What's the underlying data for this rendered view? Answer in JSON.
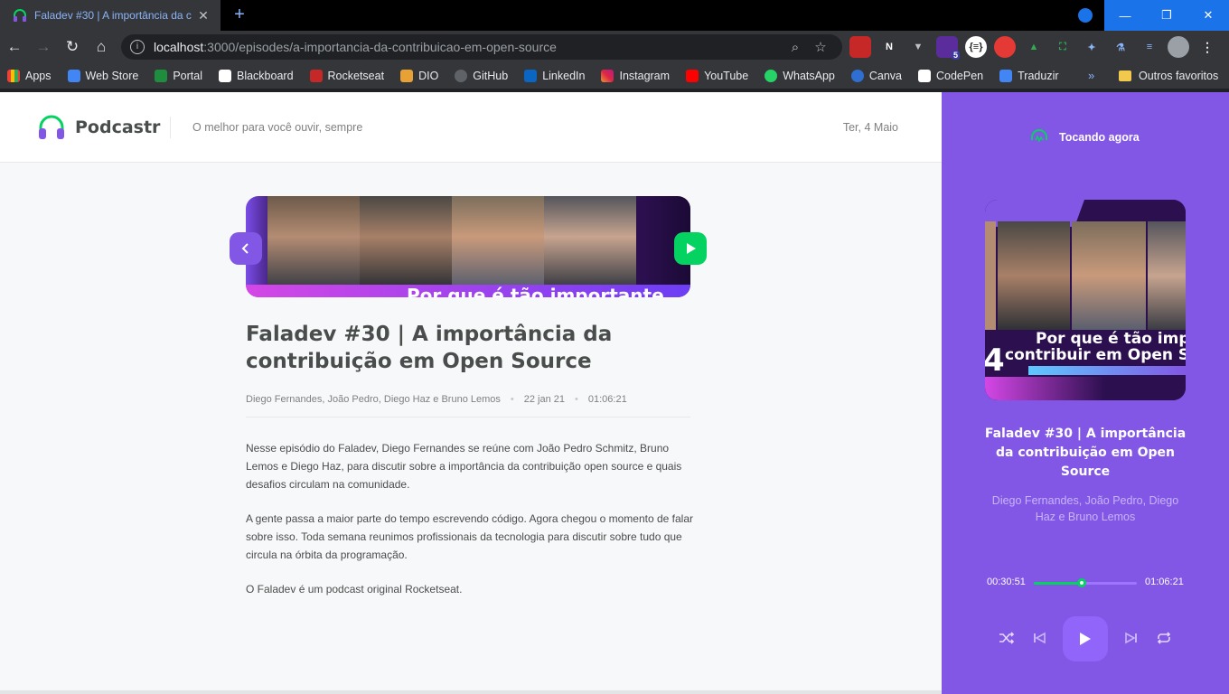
{
  "browser": {
    "tab_title": "Faladev #30 | A importância da c",
    "url_host": "localhost",
    "url_rest": ":3000/episodes/a-importancia-da-contribuicao-em-open-source",
    "bookmarks": [
      "Apps",
      "Web Store",
      "Portal",
      "Blackboard",
      "Rocketseat",
      "DIO",
      "GitHub",
      "LinkedIn",
      "Instagram",
      "YouTube",
      "WhatsApp",
      "Canva",
      "CodePen",
      "Traduzir"
    ],
    "bookmarks_more": "»",
    "other_bookmarks": "Outros favoritos",
    "ext_badge": "5"
  },
  "header": {
    "logo": "Podcastr",
    "tagline": "O melhor para você ouvir, sempre",
    "date": "Ter, 4 Maio"
  },
  "episode": {
    "thumbnail_caption": "Por que é tão importante",
    "title": "Faladev #30 | A importância da contribuição em Open Source",
    "members": "Diego Fernandes, João Pedro, Diego Haz e Bruno Lemos",
    "published_at": "22 jan 21",
    "duration": "01:06:21",
    "description": [
      "Nesse episódio do Faladev, Diego Fernandes se reúne com João Pedro Schmitz, Bruno Lemos e Diego Haz, para discutir sobre a importância da contribuição open source e quais desafios circulam na comunidade.",
      "A gente passa a maior parte do tempo escrevendo código. Agora chegou o momento de falar sobre isso. Toda semana reunimos profissionais da tecnologia para discutir sobre tudo que circula na órbita da programação.",
      "O Faladev é um podcast original Rocketseat."
    ]
  },
  "player": {
    "now_playing": "Tocando agora",
    "cover_caption_line1": "Por que é tão imp",
    "cover_caption_line2": "contribuir em Open S",
    "cover_number": "4",
    "title": "Faladev #30 | A importância da contribuição em Open Source",
    "members": "Diego Fernandes, João Pedro, Diego Haz e Bruno Lemos",
    "current_time": "00:30:51",
    "total_time": "01:06:21",
    "progress": 0.465
  },
  "colors": {
    "accent": "#8257e5",
    "green": "#04d361",
    "text": "#494d4b"
  }
}
